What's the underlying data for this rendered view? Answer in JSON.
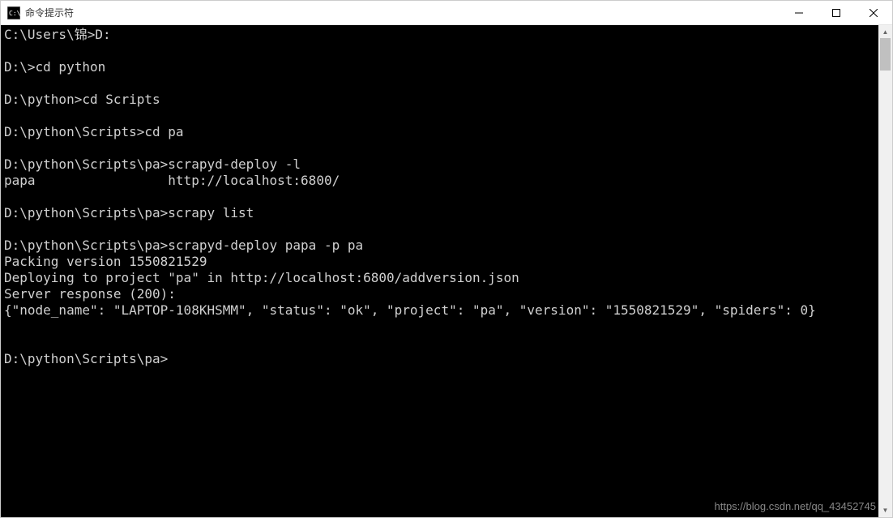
{
  "window": {
    "title": "命令提示符"
  },
  "terminal": {
    "lines": [
      "C:\\Users\\锦>D:",
      "",
      "D:\\>cd python",
      "",
      "D:\\python>cd Scripts",
      "",
      "D:\\python\\Scripts>cd pa",
      "",
      "D:\\python\\Scripts\\pa>scrapyd-deploy -l",
      "papa                 http://localhost:6800/",
      "",
      "D:\\python\\Scripts\\pa>scrapy list",
      "",
      "D:\\python\\Scripts\\pa>scrapyd-deploy papa -p pa",
      "Packing version 1550821529",
      "Deploying to project \"pa\" in http://localhost:6800/addversion.json",
      "Server response (200):",
      "{\"node_name\": \"LAPTOP-108KHSMM\", \"status\": \"ok\", \"project\": \"pa\", \"version\": \"1550821529\", \"spiders\": 0}",
      "",
      "",
      "D:\\python\\Scripts\\pa>"
    ]
  },
  "watermark": "https://blog.csdn.net/qq_43452745"
}
